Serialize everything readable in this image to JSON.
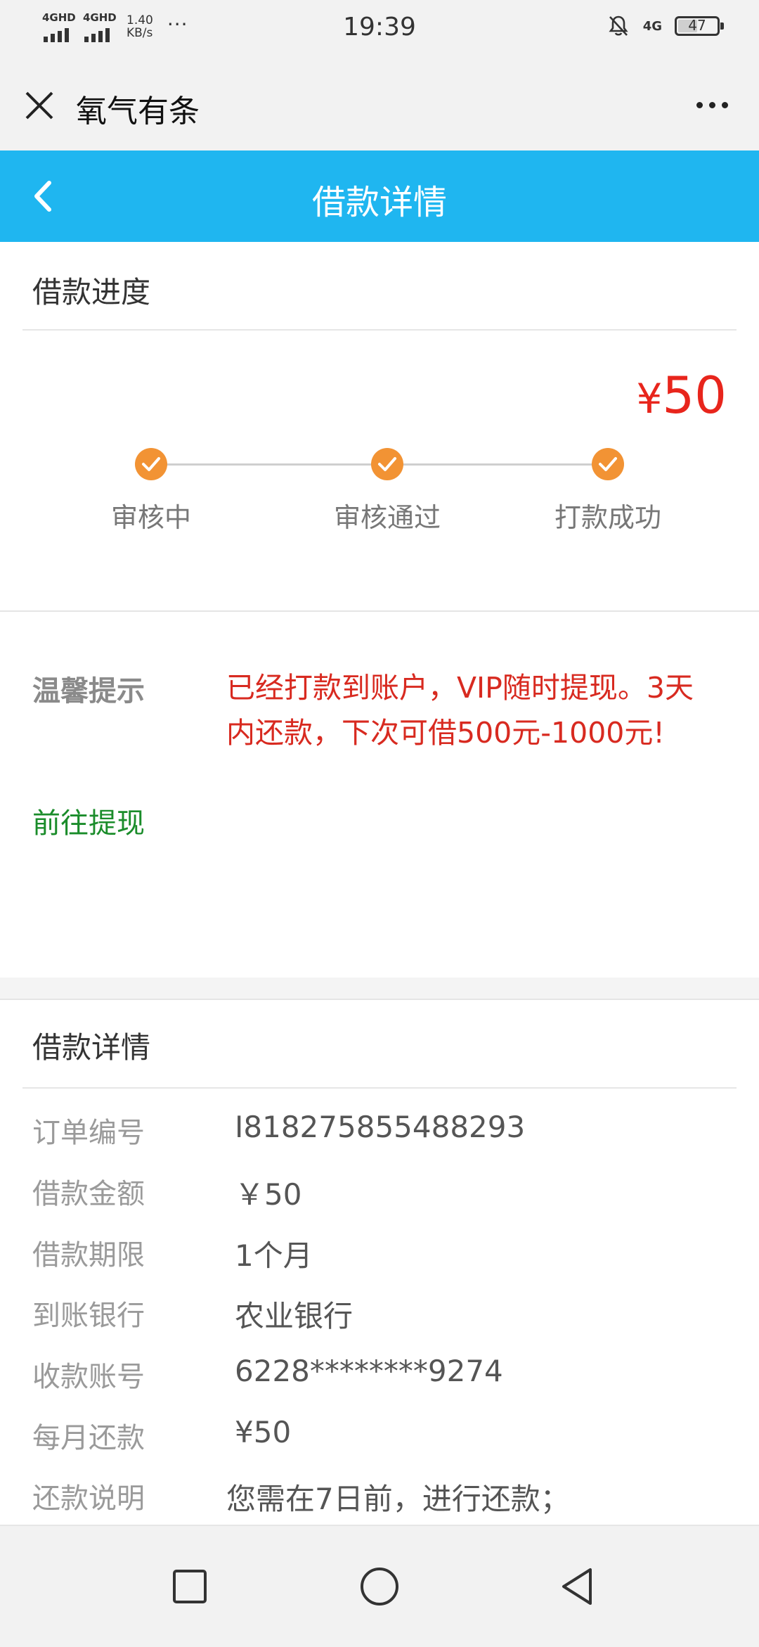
{
  "status_bar": {
    "sim1": "4GHD",
    "sim2": "4GHD",
    "speed_value": "1.40",
    "speed_unit": "KB/s",
    "more": "···",
    "time": "19:39",
    "network": "4G",
    "battery": "47"
  },
  "app_bar": {
    "title": "氧气有条",
    "close_icon": "close-icon",
    "more_icon": "more-dots-icon"
  },
  "header": {
    "title": "借款详情",
    "back_icon": "chevron-left-icon"
  },
  "progress": {
    "section_title": "借款进度",
    "currency": "¥",
    "amount": "50",
    "steps": [
      {
        "label": "审核中",
        "done": true
      },
      {
        "label": "审核通过",
        "done": true
      },
      {
        "label": "打款成功",
        "done": true
      }
    ],
    "accent_color": "#f29334"
  },
  "tip": {
    "label": "温馨提示",
    "text": "已经打款到账户，VIP随时提现。3天内还款，下次可借500元-1000元!",
    "link": "前往提现",
    "text_color": "#d82a20",
    "link_color": "#1a8c2a"
  },
  "details": {
    "section_title": "借款详情",
    "rows": [
      {
        "key": "订单编号",
        "value": "I818275855488293"
      },
      {
        "key": "借款金额",
        "value": "￥50"
      },
      {
        "key": "借款期限",
        "value": "1个月"
      },
      {
        "key": "到账银行",
        "value": "农业银行"
      },
      {
        "key": "收款账号",
        "value": "6228********9274"
      },
      {
        "key": "每月还款",
        "value": "¥50"
      },
      {
        "key": "还款说明",
        "value": "您需在7日前，进行还款；"
      }
    ]
  },
  "nav": {
    "recent_icon": "square-icon",
    "home_icon": "circle-icon",
    "back_icon": "triangle-back-icon"
  },
  "colors": {
    "header_blue": "#1fb6f0",
    "amount_red": "#e8251c"
  }
}
